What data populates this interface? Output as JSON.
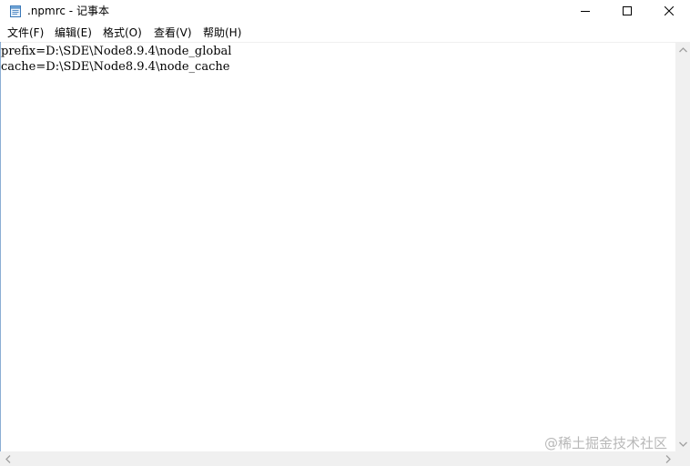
{
  "window": {
    "title": ".npmrc - 记事本",
    "icon": "notepad-icon"
  },
  "caption_buttons": {
    "minimize_icon": "minimize-icon",
    "maximize_icon": "maximize-icon",
    "close_icon": "close-icon"
  },
  "menu": {
    "items": [
      {
        "label": "文件(F)"
      },
      {
        "label": "编辑(E)"
      },
      {
        "label": "格式(O)"
      },
      {
        "label": "查看(V)"
      },
      {
        "label": "帮助(H)"
      }
    ]
  },
  "editor": {
    "lines": [
      "prefix=D:\\SDE\\Node8.9.4\\node_global",
      "cache=D:\\SDE\\Node8.9.4\\node_cache"
    ]
  },
  "watermark": {
    "text": "@稀土掘金技术社区"
  },
  "colors": {
    "scrollbar": "#f0f0f0",
    "watermark": "#b8b8b8"
  }
}
